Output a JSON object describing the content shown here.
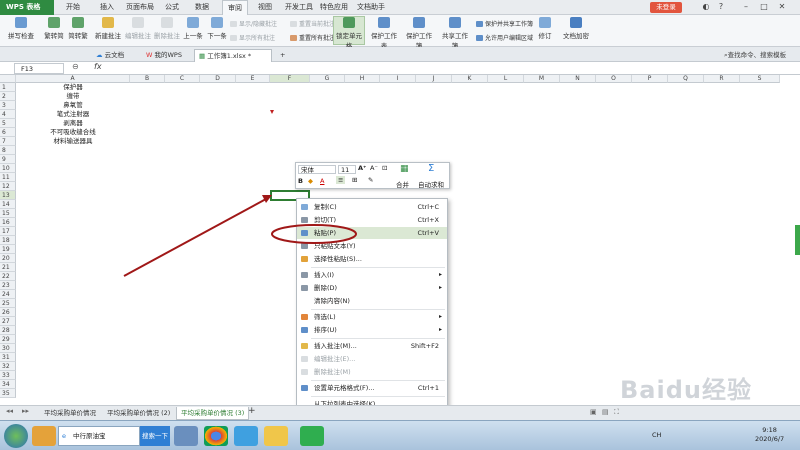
{
  "titlebar": {
    "app_name": "WPS 表格",
    "menus": [
      "开始",
      "插入",
      "页面布局",
      "公式",
      "数据",
      "审阅",
      "视图",
      "开发工具",
      "特色应用",
      "文档助手"
    ],
    "active_menu": "审阅",
    "login": "未登录"
  },
  "ribbon": {
    "spell": "拼写检查",
    "trad_to_simp": "繁转简",
    "simp_to_trad": "简转繁",
    "new_comment": "新建批注",
    "edit_comment": "编辑批注",
    "delete_comment": "删除批注",
    "prev": "上一条",
    "next": "下一条",
    "show_hide_comment": "显示/隐藏批注",
    "reset_comment": "重置当前批注",
    "show_all_comments": "显示所有批注",
    "reset_all_comments": "重置所有批注",
    "lock_cell": "锁定单元格",
    "protect_sheet": "保护工作表",
    "protect_workbook": "保护工作簿",
    "share_workbook": "共享工作簿",
    "protect_share_workbook": "保护并共享工作簿",
    "allow_edit_ranges": "允许用户编辑区域",
    "revise": "修订",
    "doc_encrypt": "文档加密"
  },
  "doc_tabs": [
    "云文档",
    "我的WPS",
    "工作簿1.xlsx *"
  ],
  "cmd_search": "查找命令、搜索模板",
  "formula_bar": {
    "cell_ref": "F13",
    "fx": "fx",
    "value": ""
  },
  "columns": [
    "A",
    "B",
    "C",
    "D",
    "E",
    "F",
    "G",
    "H",
    "I",
    "J",
    "K",
    "L",
    "M",
    "N",
    "O",
    "P",
    "Q",
    "R",
    "S"
  ],
  "rows": [
    "1",
    "2",
    "3",
    "4",
    "5",
    "6",
    "7",
    "8",
    "9",
    "10",
    "11",
    "12",
    "13",
    "14",
    "15",
    "16",
    "17",
    "18",
    "19",
    "20",
    "21",
    "22",
    "23",
    "24",
    "25",
    "26",
    "27",
    "28",
    "29",
    "30",
    "31",
    "32",
    "33",
    "34",
    "35"
  ],
  "cells_a": [
    "保护器",
    "缠带",
    "鼻氧管",
    "笔式注射器",
    "剥离器",
    "不可吸收缝合线",
    "材料输送器具"
  ],
  "mini_toolbar": {
    "font": "宋体",
    "size": "11",
    "merge": "合并",
    "autosum": "自动求和"
  },
  "context_menu": [
    {
      "label": "复制(C)",
      "shortcut": "Ctrl+C",
      "state": "normal"
    },
    {
      "label": "剪切(T)",
      "shortcut": "Ctrl+X",
      "state": "normal"
    },
    {
      "label": "粘贴(P)",
      "shortcut": "Ctrl+V",
      "state": "highlight"
    },
    {
      "label": "只粘贴文本(Y)",
      "shortcut": "",
      "state": "normal"
    },
    {
      "label": "选择性粘贴(S)...",
      "shortcut": "",
      "state": "normal"
    },
    {
      "label": "插入(I)",
      "shortcut": "",
      "state": "submenu"
    },
    {
      "label": "删除(D)",
      "shortcut": "",
      "state": "submenu"
    },
    {
      "label": "清除内容(N)",
      "shortcut": "",
      "state": "normal"
    },
    {
      "label": "筛选(L)",
      "shortcut": "",
      "state": "submenu"
    },
    {
      "label": "排序(U)",
      "shortcut": "",
      "state": "submenu"
    },
    {
      "label": "插入批注(M)...",
      "shortcut": "Shift+F2",
      "state": "normal"
    },
    {
      "label": "编辑批注(E)...",
      "shortcut": "",
      "state": "disabled"
    },
    {
      "label": "删除批注(M)",
      "shortcut": "",
      "state": "disabled"
    },
    {
      "label": "设置单元格格式(F)...",
      "shortcut": "Ctrl+1",
      "state": "normal"
    },
    {
      "label": "从下拉列表中选择(K)...",
      "shortcut": "",
      "state": "normal"
    }
  ],
  "sheets": [
    "平均采购单价情况",
    "平均采购单价情况 (2)",
    "平均采购单价情况 (3)"
  ],
  "active_sheet": "平均采购单价情况 (3)",
  "taskbar": {
    "ie_tab": "中行原油宝",
    "search_btn": "搜索一下",
    "time": "9:18",
    "date": "2020/6/7",
    "ime": "CH"
  },
  "watermark": "Baidu经验",
  "colors": {
    "brand": "#2f8b41",
    "highlight": "#dbe8d4",
    "annotation": "#a01818",
    "login": "#e2553e"
  }
}
